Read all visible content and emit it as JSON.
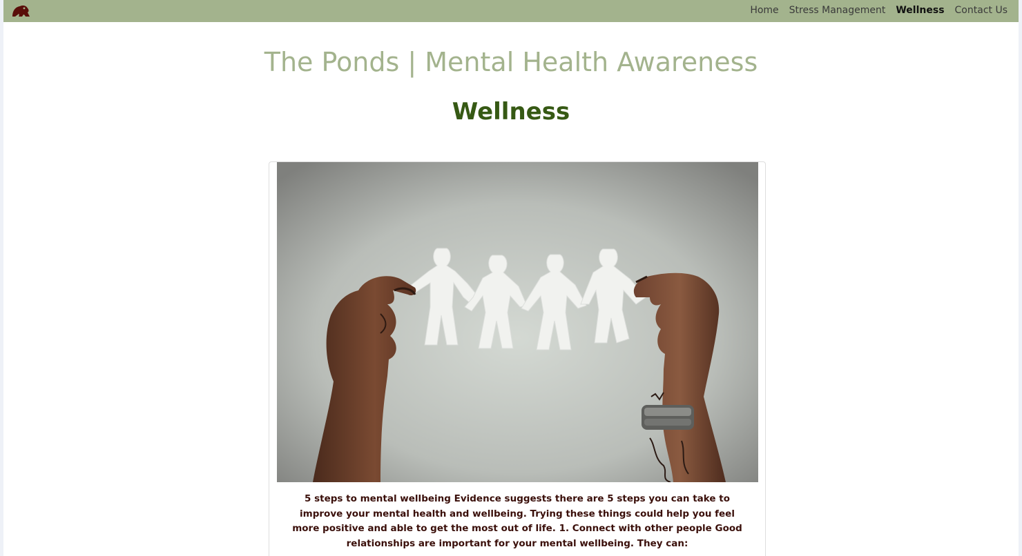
{
  "nav": {
    "logo_icon": "frog-logo-icon",
    "links": [
      {
        "label": "Home",
        "active": false
      },
      {
        "label": "Stress Management",
        "active": false
      },
      {
        "label": "Wellness",
        "active": true
      },
      {
        "label": "Contact Us",
        "active": false
      }
    ]
  },
  "header": {
    "site_title": "The Ponds | Mental Health Awareness",
    "page_heading": "Wellness"
  },
  "card": {
    "image_icon": "hands-holding-paper-people-image",
    "text": "5 steps to mental wellbeing Evidence suggests there are 5 steps you can take to improve your mental health and wellbeing. Trying these things could help you feel more positive and able to get the most out of life. 1. Connect with other people Good relationships are important for your mental wellbeing. They can:"
  },
  "colors": {
    "navbar": "#a3b38d",
    "title": "#a3b38d",
    "heading": "#365914",
    "body_text": "#3a0f0a",
    "logo": "#5a0f0a"
  }
}
